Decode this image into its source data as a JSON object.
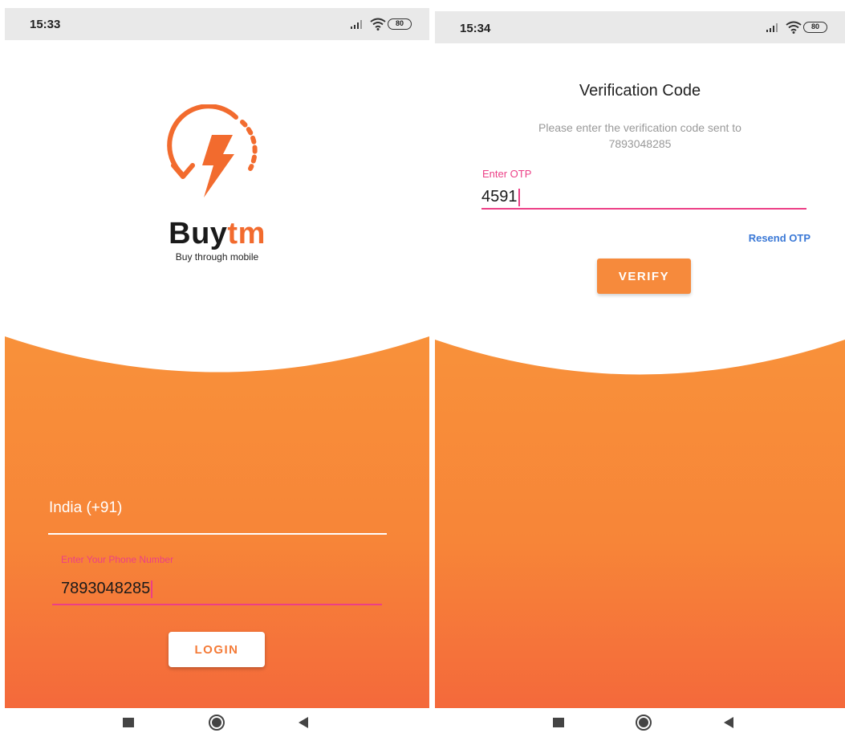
{
  "login_screen": {
    "status_time": "15:33",
    "battery": "80",
    "brand_part1": "Buy",
    "brand_part2": "tm",
    "tagline": "Buy through mobile",
    "country": "India (+91)",
    "phone_label": "Enter Your Phone Number",
    "phone_value": "7893048285",
    "login_label": "LOGIN"
  },
  "verify_screen": {
    "status_time": "15:34",
    "battery": "80",
    "title": "Verification Code",
    "subtitle_line1": "Please enter the verification code sent to",
    "subtitle_line2": "7893048285",
    "otp_label": "Enter OTP",
    "otp_value": "4591",
    "resend_label": "Resend OTP",
    "verify_label": "VERIFY"
  },
  "colors": {
    "accent_orange": "#f68a3c",
    "brand_orange": "#f26b2e",
    "field_pink": "#ec3f86",
    "link_blue": "#3a78d6"
  },
  "icons": [
    "signal-icon",
    "wifi-icon",
    "battery-icon",
    "buytm-logo-icon",
    "nav-recents-icon",
    "nav-home-icon",
    "nav-back-icon"
  ]
}
